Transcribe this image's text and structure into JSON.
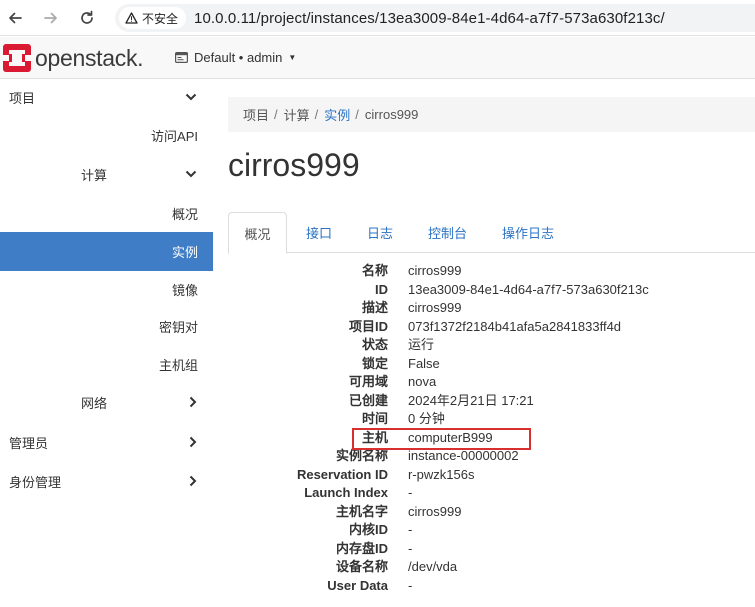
{
  "browser": {
    "security_label": "不安全",
    "url": "10.0.0.11/project/instances/13ea3009-84e1-4d64-a7f7-573a630f213c/"
  },
  "topbar": {
    "logo_text": "openstack.",
    "domain_selector": "Default • admin",
    "brand_color": "#da1a32"
  },
  "sidebar": {
    "items": [
      {
        "label": "项目",
        "chevron": "down"
      },
      {
        "label": "访问API"
      },
      {
        "label": "计算",
        "chevron": "down"
      },
      {
        "label": "概况"
      },
      {
        "label": "实例",
        "active": true
      },
      {
        "label": "镜像"
      },
      {
        "label": "密钥对"
      },
      {
        "label": "主机组"
      },
      {
        "label": "网络",
        "chevron": "right"
      },
      {
        "label": "管理员",
        "chevron": "right"
      },
      {
        "label": "身份管理",
        "chevron": "right"
      }
    ],
    "active_color": "#3f7ec6"
  },
  "breadcrumb": {
    "items": [
      "项目",
      "计算",
      "实例",
      "cirros999"
    ]
  },
  "page_title": "cirros999",
  "tabs": [
    "概况",
    "接口",
    "日志",
    "控制台",
    "操作日志"
  ],
  "details": [
    {
      "key": "名称",
      "value": "cirros999"
    },
    {
      "key": "ID",
      "value": "13ea3009-84e1-4d64-a7f7-573a630f213c"
    },
    {
      "key": "描述",
      "value": "cirros999"
    },
    {
      "key": "项目ID",
      "value": "073f1372f2184b41afa5a2841833ff4d"
    },
    {
      "key": "状态",
      "value": "运行"
    },
    {
      "key": "锁定",
      "value": "False"
    },
    {
      "key": "可用域",
      "value": "nova"
    },
    {
      "key": "已创建",
      "value": "2024年2月21日 17:21"
    },
    {
      "key": "时间",
      "value": "0 分钟"
    },
    {
      "key": "主机",
      "value": "computerB999"
    },
    {
      "key": "实例名称",
      "value": "instance-00000002"
    },
    {
      "key": "Reservation ID",
      "value": "r-pwzk156s"
    },
    {
      "key": "Launch Index",
      "value": "-"
    },
    {
      "key": "主机名字",
      "value": "cirros999"
    },
    {
      "key": "内核ID",
      "value": "-"
    },
    {
      "key": "内存盘ID",
      "value": "-"
    },
    {
      "key": "设备名称",
      "value": "/dev/vda"
    },
    {
      "key": "User Data",
      "value": "-"
    }
  ],
  "highlight_color": "#d9302f"
}
